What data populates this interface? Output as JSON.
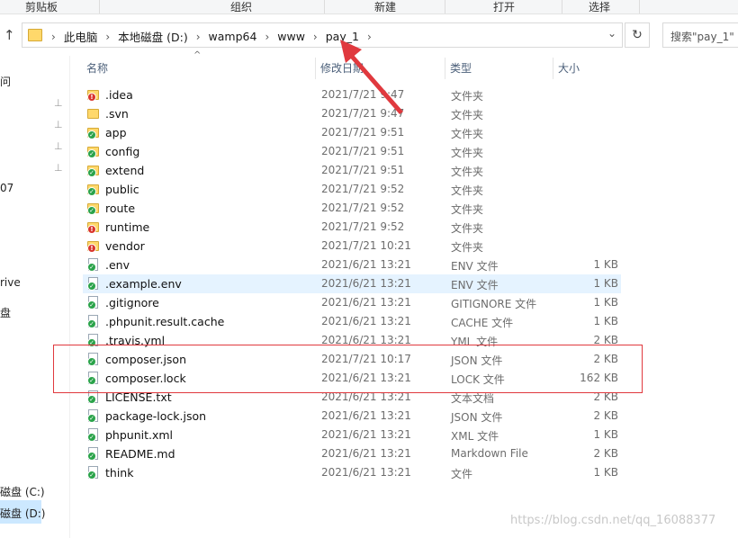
{
  "ribbon": {
    "clipboard": "剪贴板",
    "organize": "组织",
    "new": "新建",
    "open": "打开",
    "select": "选择"
  },
  "address": {
    "crumbs": [
      "此电脑",
      "本地磁盘 (D:)",
      "wamp64",
      "www",
      "pay_1"
    ],
    "search_placeholder": "搜索\"pay_1\""
  },
  "nav": {
    "items": [
      "问",
      "07",
      "rive",
      "盘",
      "磁盘 (C:)",
      "磁盘 (D:)"
    ]
  },
  "columns": {
    "name": "名称",
    "date": "修改日期",
    "type": "类型",
    "size": "大小"
  },
  "files": [
    {
      "name": ".idea",
      "date": "2021/7/21 9:47",
      "type": "文件夹",
      "size": "",
      "kind": "folder",
      "status": "err"
    },
    {
      "name": ".svn",
      "date": "2021/7/21 9:47",
      "type": "文件夹",
      "size": "",
      "kind": "folder",
      "status": "none"
    },
    {
      "name": "app",
      "date": "2021/7/21 9:51",
      "type": "文件夹",
      "size": "",
      "kind": "folder",
      "status": "ok"
    },
    {
      "name": "config",
      "date": "2021/7/21 9:51",
      "type": "文件夹",
      "size": "",
      "kind": "folder",
      "status": "ok"
    },
    {
      "name": "extend",
      "date": "2021/7/21 9:51",
      "type": "文件夹",
      "size": "",
      "kind": "folder",
      "status": "ok"
    },
    {
      "name": "public",
      "date": "2021/7/21 9:52",
      "type": "文件夹",
      "size": "",
      "kind": "folder",
      "status": "ok"
    },
    {
      "name": "route",
      "date": "2021/7/21 9:52",
      "type": "文件夹",
      "size": "",
      "kind": "folder",
      "status": "ok"
    },
    {
      "name": "runtime",
      "date": "2021/7/21 9:52",
      "type": "文件夹",
      "size": "",
      "kind": "folder",
      "status": "err"
    },
    {
      "name": "vendor",
      "date": "2021/7/21 10:21",
      "type": "文件夹",
      "size": "",
      "kind": "folder",
      "status": "err"
    },
    {
      "name": ".env",
      "date": "2021/6/21 13:21",
      "type": "ENV 文件",
      "size": "1 KB",
      "kind": "file",
      "status": "ok"
    },
    {
      "name": ".example.env",
      "date": "2021/6/21 13:21",
      "type": "ENV 文件",
      "size": "1 KB",
      "kind": "file",
      "status": "ok"
    },
    {
      "name": ".gitignore",
      "date": "2021/6/21 13:21",
      "type": "GITIGNORE 文件",
      "size": "1 KB",
      "kind": "file",
      "status": "ok"
    },
    {
      "name": ".phpunit.result.cache",
      "date": "2021/6/21 13:21",
      "type": "CACHE 文件",
      "size": "1 KB",
      "kind": "file",
      "status": "ok"
    },
    {
      "name": ".travis.yml",
      "date": "2021/6/21 13:21",
      "type": "YML 文件",
      "size": "2 KB",
      "kind": "file",
      "status": "ok"
    },
    {
      "name": "composer.json",
      "date": "2021/7/21 10:17",
      "type": "JSON 文件",
      "size": "2 KB",
      "kind": "file",
      "status": "ok"
    },
    {
      "name": "composer.lock",
      "date": "2021/6/21 13:21",
      "type": "LOCK 文件",
      "size": "162 KB",
      "kind": "file",
      "status": "ok"
    },
    {
      "name": "LICENSE.txt",
      "date": "2021/6/21 13:21",
      "type": "文本文档",
      "size": "2 KB",
      "kind": "file",
      "status": "ok"
    },
    {
      "name": "package-lock.json",
      "date": "2021/6/21 13:21",
      "type": "JSON 文件",
      "size": "2 KB",
      "kind": "file",
      "status": "ok"
    },
    {
      "name": "phpunit.xml",
      "date": "2021/6/21 13:21",
      "type": "XML 文件",
      "size": "1 KB",
      "kind": "file",
      "status": "ok"
    },
    {
      "name": "README.md",
      "date": "2021/6/21 13:21",
      "type": "Markdown File",
      "size": "2 KB",
      "kind": "file",
      "status": "ok"
    },
    {
      "name": "think",
      "date": "2021/6/21 13:21",
      "type": "文件",
      "size": "1 KB",
      "kind": "file",
      "status": "ok"
    }
  ],
  "colors": {
    "ok_badge": "#2aa34a",
    "err_badge": "#d9342b",
    "annotation": "#e0393e",
    "selection": "#cce8ff"
  },
  "watermark": "https://blog.csdn.net/qq_16088377"
}
